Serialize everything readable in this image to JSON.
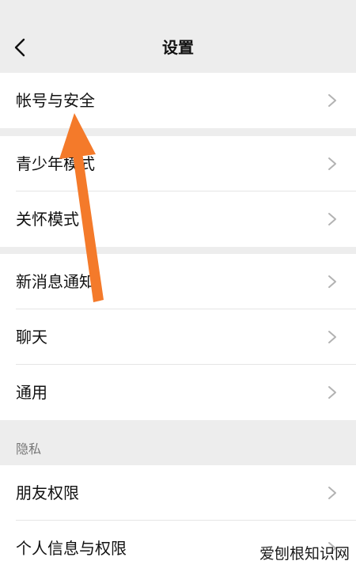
{
  "header": {
    "title": "设置",
    "back_icon": "chevron-left-icon"
  },
  "groups": [
    {
      "items": [
        {
          "label": "帐号与安全"
        }
      ]
    },
    {
      "items": [
        {
          "label": "青少年模式"
        },
        {
          "label": "关怀模式"
        }
      ]
    },
    {
      "items": [
        {
          "label": "新消息通知"
        },
        {
          "label": "聊天"
        },
        {
          "label": "通用"
        }
      ]
    }
  ],
  "privacy": {
    "section_label": "隐私",
    "items": [
      {
        "label": "朋友权限"
      },
      {
        "label": "个人信息与权限"
      }
    ]
  },
  "watermark": "爱刨根知识网",
  "colors": {
    "background": "#ededed",
    "row": "#ffffff",
    "arrow": "#f47a2a",
    "chevron": "#b2b2b2"
  }
}
